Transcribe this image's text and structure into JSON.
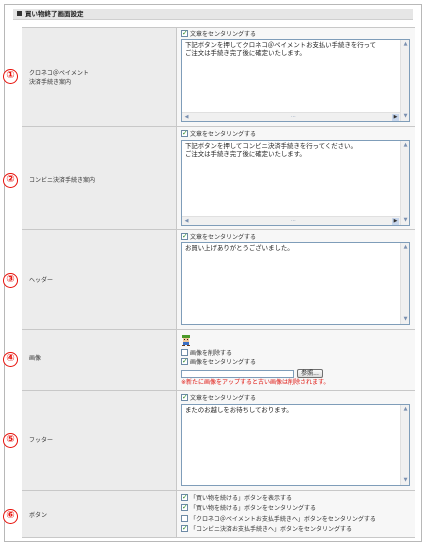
{
  "section_title": "買い物終了画面設定",
  "checkbox_center_label": "文章をセンタリングする",
  "rows": [
    {
      "num": "①",
      "label": "クロネコ＠ペイメント\n決済手続き案内",
      "center_checked": true,
      "textarea_value": "下記ボタンを押してクロネコ＠ペイメントお支払い手続きを行って\nご注文は手続き完了後に確定いたします。"
    },
    {
      "num": "②",
      "label": "コンビニ決済手続き案内",
      "center_checked": true,
      "textarea_value": "下記ボタンを押してコンビニ決済手続きを行ってください。\nご注文は手続き完了後に確定いたします。"
    },
    {
      "num": "③",
      "label": "ヘッダー",
      "center_checked": true,
      "textarea_value": "お買い上げありがとうございました。"
    },
    {
      "num": "④",
      "label": "画像",
      "delete_image_label": "画像を削除する",
      "delete_image_checked": false,
      "center_image_label": "画像をセンタリングする",
      "center_image_checked": true,
      "browse_label": "参照...",
      "file_value": "",
      "warning": "※新たに画像をアップすると古い画像は削除されます。"
    },
    {
      "num": "⑤",
      "label": "フッター",
      "center_checked": true,
      "textarea_value": "またのお越しをお待ちしております。"
    },
    {
      "num": "⑥",
      "label": "ボタン",
      "options": [
        {
          "label": "「買い物を続ける」ボタンを表示する",
          "checked": true
        },
        {
          "label": "「買い物を続ける」ボタンをセンタリングする",
          "checked": true
        },
        {
          "label": "「クロネコ＠ペイメントお支払手続きへ」ボタンをセンタリングする",
          "checked": false
        },
        {
          "label": "「コンビニ決済お支払手続きへ」ボタンをセンタリングする",
          "checked": true
        }
      ]
    }
  ],
  "colors": {
    "number_circle": "#e8120c",
    "warning_text": "#e0150f",
    "label_bg": "#ececec",
    "content_bg": "#f7f7f7",
    "textarea_border": "#7f9db9",
    "check_mark": "#2d8a2d"
  },
  "icons": {
    "image_thumbnail": "character-thumbnail-icon",
    "check": "checkmark-icon"
  }
}
